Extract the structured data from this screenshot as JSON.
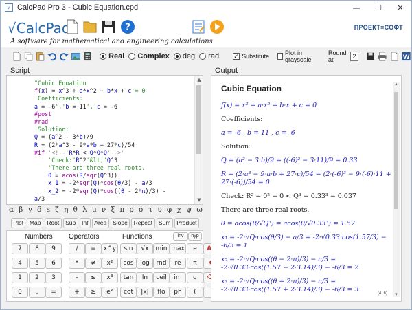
{
  "window": {
    "title": "CalcPad Pro 3 - Cubic Equation.cpd",
    "minimize": "—",
    "maximize": "☐",
    "close": "✕"
  },
  "brand": {
    "logo": "√CalcPad",
    "logo_sup": "2",
    "tagline": "A software for mathematical and engineering calculations",
    "company": "ПРОЕКТ≡СОФТ"
  },
  "toolbar": {
    "real_label": "Real",
    "complex_label": "Complex",
    "deg_label": "deg",
    "rad_label": "rad",
    "substitute_label": "Substitute",
    "grayscale_label": "Plot in grayscale",
    "round_label": "Round at",
    "round_value": "2"
  },
  "script": {
    "title": "Script",
    "lines": [
      [
        {
          "t": "\"Cubic Equation",
          "c": "c-com"
        }
      ],
      [
        {
          "t": "f",
          "c": "c-kw"
        },
        {
          "t": "(",
          "c": "c-op"
        },
        {
          "t": "x",
          "c": "c-var"
        },
        {
          "t": ") = ",
          "c": "c-op"
        },
        {
          "t": "x",
          "c": "c-var"
        },
        {
          "t": "^3 + ",
          "c": "c-op"
        },
        {
          "t": "a",
          "c": "c-var"
        },
        {
          "t": "*",
          "c": "c-op"
        },
        {
          "t": "x",
          "c": "c-var"
        },
        {
          "t": "^2 + ",
          "c": "c-op"
        },
        {
          "t": "b",
          "c": "c-var"
        },
        {
          "t": "*",
          "c": "c-op"
        },
        {
          "t": "x",
          "c": "c-var"
        },
        {
          "t": " + ",
          "c": "c-op"
        },
        {
          "t": "c",
          "c": "c-var"
        },
        {
          "t": "'= 0",
          "c": "c-com"
        }
      ],
      [
        {
          "t": "'Coefficients:",
          "c": "c-com"
        }
      ],
      [
        {
          "t": "a",
          "c": "c-var"
        },
        {
          "t": " = -6",
          "c": "c-op"
        },
        {
          "t": "','",
          "c": "c-com"
        },
        {
          "t": "b",
          "c": "c-var"
        },
        {
          "t": " = 11",
          "c": "c-op"
        },
        {
          "t": "','",
          "c": "c-com"
        },
        {
          "t": "c",
          "c": "c-var"
        },
        {
          "t": " = -6",
          "c": "c-op"
        }
      ],
      [
        {
          "t": "#post",
          "c": "c-kw"
        }
      ],
      [
        {
          "t": "#rad",
          "c": "c-kw"
        }
      ],
      [
        {
          "t": "'Solution:",
          "c": "c-com"
        }
      ],
      [
        {
          "t": "Q",
          "c": "c-var"
        },
        {
          "t": " = (",
          "c": "c-op"
        },
        {
          "t": "a",
          "c": "c-var"
        },
        {
          "t": "^2 - 3*",
          "c": "c-op"
        },
        {
          "t": "b",
          "c": "c-var"
        },
        {
          "t": ")/9",
          "c": "c-op"
        }
      ],
      [
        {
          "t": "R",
          "c": "c-var"
        },
        {
          "t": " = (2*",
          "c": "c-op"
        },
        {
          "t": "a",
          "c": "c-var"
        },
        {
          "t": "^3 - 9*",
          "c": "c-op"
        },
        {
          "t": "a",
          "c": "c-var"
        },
        {
          "t": "*",
          "c": "c-op"
        },
        {
          "t": "b",
          "c": "c-var"
        },
        {
          "t": " + 27*",
          "c": "c-op"
        },
        {
          "t": "c",
          "c": "c-var"
        },
        {
          "t": ")/54",
          "c": "c-op"
        }
      ],
      [
        {
          "t": "#if ",
          "c": "c-kw"
        },
        {
          "t": "'<!--'",
          "c": "c-html"
        },
        {
          "t": "R",
          "c": "c-var"
        },
        {
          "t": "*",
          "c": "c-op"
        },
        {
          "t": "R",
          "c": "c-var"
        },
        {
          "t": " < ",
          "c": "c-op"
        },
        {
          "t": "Q",
          "c": "c-var"
        },
        {
          "t": "*",
          "c": "c-op"
        },
        {
          "t": "Q",
          "c": "c-var"
        },
        {
          "t": "*",
          "c": "c-op"
        },
        {
          "t": "Q",
          "c": "c-var"
        },
        {
          "t": "'-->'",
          "c": "c-html"
        }
      ],
      [
        {
          "t": "    'Check:'",
          "c": "c-com"
        },
        {
          "t": "R",
          "c": "c-var"
        },
        {
          "t": "^2",
          "c": "c-op"
        },
        {
          "t": "'&lt;'",
          "c": "c-com"
        },
        {
          "t": "Q",
          "c": "c-var"
        },
        {
          "t": "^3",
          "c": "c-op"
        }
      ],
      [
        {
          "t": "    'There are three real roots.",
          "c": "c-com"
        }
      ],
      [
        {
          "t": "    θ",
          "c": "c-var"
        },
        {
          "t": " = ",
          "c": "c-op"
        },
        {
          "t": "acos",
          "c": "c-kw"
        },
        {
          "t": "(",
          "c": "c-op"
        },
        {
          "t": "R",
          "c": "c-var"
        },
        {
          "t": "/",
          "c": "c-op"
        },
        {
          "t": "sqr",
          "c": "c-kw"
        },
        {
          "t": "(",
          "c": "c-op"
        },
        {
          "t": "Q",
          "c": "c-var"
        },
        {
          "t": "^3))",
          "c": "c-op"
        }
      ],
      [
        {
          "t": "    x_1",
          "c": "c-var"
        },
        {
          "t": " = -2*",
          "c": "c-op"
        },
        {
          "t": "sqr",
          "c": "c-kw"
        },
        {
          "t": "(",
          "c": "c-op"
        },
        {
          "t": "Q",
          "c": "c-var"
        },
        {
          "t": ")*",
          "c": "c-op"
        },
        {
          "t": "cos",
          "c": "c-kw"
        },
        {
          "t": "(",
          "c": "c-op"
        },
        {
          "t": "θ",
          "c": "c-var"
        },
        {
          "t": "/3) - ",
          "c": "c-op"
        },
        {
          "t": "a",
          "c": "c-var"
        },
        {
          "t": "/3",
          "c": "c-op"
        }
      ],
      [
        {
          "t": "    x_2",
          "c": "c-var"
        },
        {
          "t": " = -2*",
          "c": "c-op"
        },
        {
          "t": "sqr",
          "c": "c-kw"
        },
        {
          "t": "(",
          "c": "c-op"
        },
        {
          "t": "Q",
          "c": "c-var"
        },
        {
          "t": ")*",
          "c": "c-op"
        },
        {
          "t": "cos",
          "c": "c-kw"
        },
        {
          "t": "((",
          "c": "c-op"
        },
        {
          "t": "θ",
          "c": "c-var"
        },
        {
          "t": " - 2*",
          "c": "c-op"
        },
        {
          "t": "π",
          "c": "c-var"
        },
        {
          "t": ")/3) -",
          "c": "c-op"
        }
      ],
      [
        {
          "t": "a",
          "c": "c-var"
        },
        {
          "t": "/3",
          "c": "c-op"
        }
      ]
    ]
  },
  "greek": [
    "α",
    "β",
    "γ",
    "δ",
    "ε",
    "ζ",
    "η",
    "θ",
    "λ",
    "μ",
    "ν",
    "ξ",
    "π",
    "ρ",
    "σ",
    "τ",
    "υ",
    "φ",
    "χ",
    "ψ",
    "ω"
  ],
  "functions_row": [
    "Plot",
    "Map",
    "Root",
    "Sup",
    "Inf",
    "Area",
    "Slope",
    "Repeat",
    "Sum",
    "Product"
  ],
  "keypad": {
    "numbers_label": "Numbers",
    "operators_label": "Operators",
    "functions_label": "Functions",
    "inv_label": "inv",
    "hyp_label": "hyp",
    "rows": [
      [
        "7",
        "8",
        "9",
        "/",
        "≡",
        "x^y",
        "sin",
        "√x",
        "min",
        "max",
        "e",
        "AC"
      ],
      [
        "4",
        "5",
        "6",
        "*",
        "≠",
        "x²",
        "cos",
        "log",
        "rnd",
        "re",
        "π",
        "C"
      ],
      [
        "1",
        "2",
        "3",
        "-",
        "≤",
        "x³",
        "tan",
        "ln",
        "ceil",
        "im",
        "g",
        "⌫"
      ],
      [
        "0",
        ".",
        "=",
        "+",
        "≥",
        "eˣ",
        "cot",
        "|x|",
        "flo",
        "ph",
        "(",
        ")"
      ]
    ],
    "red_keys": [
      "AC",
      "C",
      "⌫"
    ]
  },
  "output": {
    "title": "Output",
    "heading": "Cubic Equation",
    "lines": [
      "f(x) = x³ + a·x² + b·x + c = 0",
      "Coefficients:",
      "a = -6 , b = 11 , c = -6",
      "Solution:",
      "Q = (a² − 3·b)/9 = ((-6)² − 3·11)/9 = 0.33",
      "R = (2·a³ − 9·a·b + 27·c)/54 = (2·(-6)³ − 9·(-6)·11 + 27·(-6))/54 = 0",
      "Check: R² = 0² = 0 < Q³ = 0.33³ = 0.037",
      "There are three real roots.",
      "θ = acos(R/√Q³) = acos(0/√0.33³) = 1.57",
      "x₁ = -2·√Q·cos(θ/3) − a/3 = -2·√0.33·cos(1.57/3) − -6/3 = 1",
      "x₂ = -2·√Q·cos((θ − 2·π)/3) − a/3 = -2·√0.33·cos((1.57 − 2·3.14)/3) − -6/3 = 2",
      "x₃ = -2·√Q·cos((θ + 2·π)/3) − a/3 = -2·√0.33·cos((1.57 + 2·3.14)/3) − -6/3 = 3"
    ],
    "coord": "(4, 6)"
  }
}
